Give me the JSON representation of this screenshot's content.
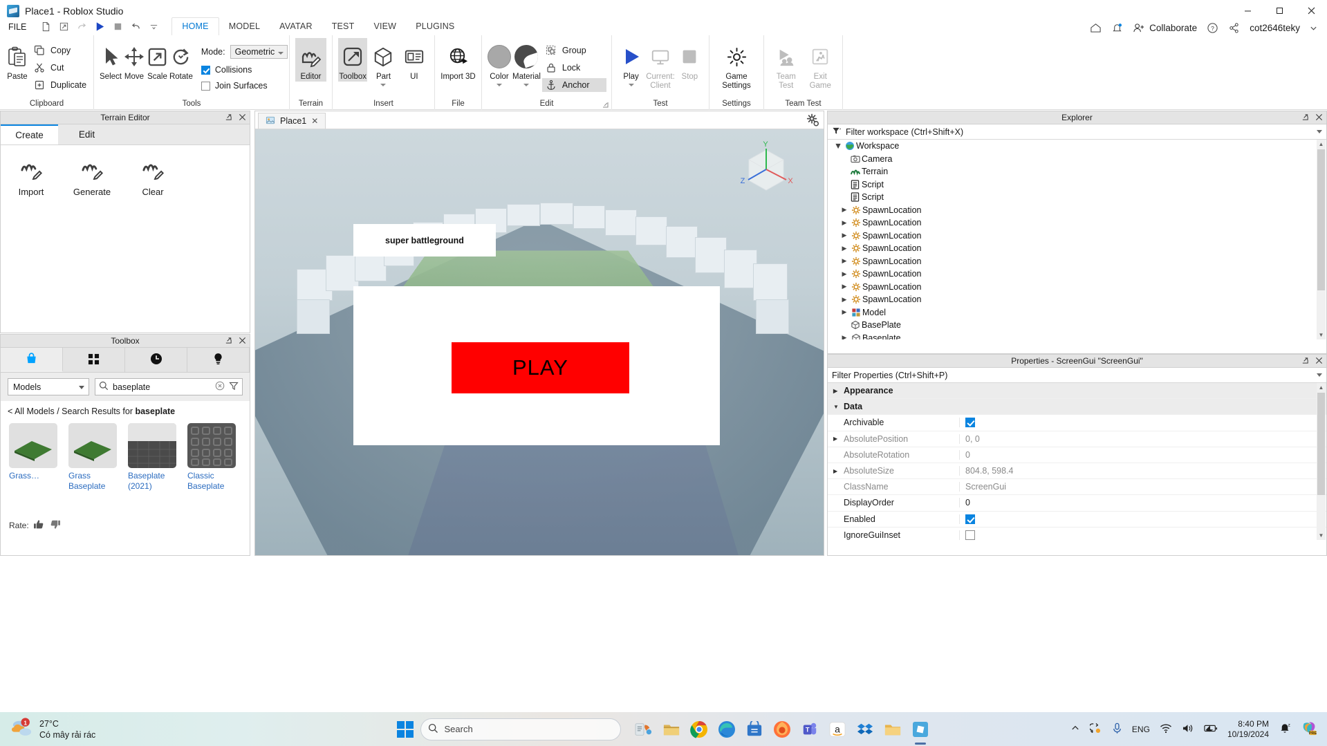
{
  "window": {
    "title": "Place1 - Roblox Studio",
    "minimize": "—",
    "maximize": "❐",
    "close": "✕"
  },
  "menu": {
    "file_label": "FILE",
    "quick_access": [
      "new-document-icon",
      "share-icon",
      "redo-icon",
      "play-icon",
      "stop-icon",
      "undo-icon",
      "more-icon"
    ],
    "tabs": [
      {
        "label": "HOME",
        "active": true
      },
      {
        "label": "MODEL",
        "active": false
      },
      {
        "label": "AVATAR",
        "active": false
      },
      {
        "label": "TEST",
        "active": false
      },
      {
        "label": "VIEW",
        "active": false
      },
      {
        "label": "PLUGINS",
        "active": false
      }
    ],
    "collaborate_label": "Collaborate",
    "user_name": "cot2646teky"
  },
  "ribbon": {
    "groups": [
      {
        "name": "Clipboard",
        "label": "Clipboard",
        "big": [
          {
            "label": "Paste",
            "icon": "paste-icon"
          }
        ],
        "small": [
          {
            "label": "Copy",
            "icon": "copy-icon"
          },
          {
            "label": "Cut",
            "icon": "cut-icon"
          },
          {
            "label": "Duplicate",
            "icon": "duplicate-icon"
          }
        ]
      },
      {
        "name": "Tools",
        "label": "Tools",
        "big": [
          {
            "label": "Select",
            "icon": "cursor-icon"
          },
          {
            "label": "Move",
            "icon": "move-icon"
          },
          {
            "label": "Scale",
            "icon": "scale-icon"
          },
          {
            "label": "Rotate",
            "icon": "rotate-icon"
          }
        ],
        "mode_label": "Mode:",
        "mode_value": "Geometric",
        "checkboxes": [
          {
            "label": "Collisions",
            "checked": true
          },
          {
            "label": "Join Surfaces",
            "checked": false
          }
        ]
      },
      {
        "name": "Terrain",
        "label": "Terrain",
        "big": [
          {
            "label": "Editor",
            "icon": "terrain-editor-icon",
            "selected": true
          }
        ]
      },
      {
        "name": "Insert",
        "label": "Insert",
        "big": [
          {
            "label": "Toolbox",
            "icon": "toolbox-icon",
            "selected": true
          },
          {
            "label": "Part",
            "icon": "part-cube-icon",
            "dropdown": true
          },
          {
            "label": "UI",
            "icon": "ui-icon"
          }
        ]
      },
      {
        "name": "File",
        "label": "File",
        "big": [
          {
            "label": "Import 3D",
            "icon": "import-3d-icon"
          }
        ]
      },
      {
        "name": "Edit",
        "label": "Edit",
        "big": [
          {
            "label": "Color",
            "icon": "color-swatch-icon",
            "dropdown": true
          },
          {
            "label": "Material",
            "icon": "material-sphere-icon",
            "dropdown": true
          }
        ],
        "small": [
          {
            "label": "Group",
            "icon": "group-icon",
            "dropdown": true
          },
          {
            "label": "Lock",
            "icon": "lock-icon",
            "dropdown": true
          },
          {
            "label": "Anchor",
            "icon": "anchor-icon",
            "selected": true
          }
        ]
      },
      {
        "name": "Test",
        "label": "Test",
        "big": [
          {
            "label": "Play",
            "icon": "play-triangle-icon",
            "dropdown": true
          },
          {
            "label": "Current: Client",
            "icon": "monitor-icon",
            "disabled": true
          },
          {
            "label": "Stop",
            "icon": "stop-square-icon",
            "disabled": true
          }
        ]
      },
      {
        "name": "Settings",
        "label": "Settings",
        "big": [
          {
            "label": "Game Settings",
            "icon": "gear-icon"
          }
        ]
      },
      {
        "name": "TeamTest",
        "label": "Team Test",
        "big": [
          {
            "label": "Team Test",
            "icon": "team-test-icon",
            "disabled": true
          },
          {
            "label": "Exit Game",
            "icon": "exit-game-icon",
            "disabled": true
          }
        ]
      }
    ]
  },
  "terrain_editor": {
    "title": "Terrain Editor",
    "tabs": [
      {
        "label": "Create",
        "active": true
      },
      {
        "label": "Edit",
        "active": false
      }
    ],
    "tools": [
      {
        "label": "Import",
        "icon": "terrain-import-icon"
      },
      {
        "label": "Generate",
        "icon": "terrain-generate-icon"
      },
      {
        "label": "Clear",
        "icon": "terrain-clear-icon"
      }
    ]
  },
  "toolbox": {
    "title": "Toolbox",
    "tabs": [
      {
        "icon": "shop-bag-icon",
        "active": true
      },
      {
        "icon": "inventory-grid-icon",
        "active": false
      },
      {
        "icon": "recent-clock-icon",
        "active": false
      },
      {
        "icon": "creations-bulb-icon",
        "active": false
      }
    ],
    "category": "Models",
    "search_value": "baseplate",
    "search_placeholder": "Search",
    "clear_icon": "clear-circle-icon",
    "filter_icon": "filter-icon",
    "breadcrumb_prefix": "< All Models / Search Results for ",
    "breadcrumb_query": "baseplate",
    "results": [
      {
        "name": "Grass…",
        "thumb": "grass-plate-thumb"
      },
      {
        "name": "Grass Baseplate",
        "thumb": "grass-plate-thumb"
      },
      {
        "name": "Baseplate (2021)",
        "thumb": "dark-baseplate-thumb"
      },
      {
        "name": "Classic Baseplate",
        "thumb": "studs-baseplate-thumb"
      }
    ],
    "rate_label": "Rate:"
  },
  "viewport": {
    "tab_label": "Place1",
    "tab_close": "✕",
    "tab_icon": "place-file-icon",
    "settings_icon": "viewport-settings-icon",
    "axis_labels": {
      "x": "X",
      "y": "Y",
      "z": "Z"
    },
    "gui_title_text": "super battleground",
    "play_button_label": "PLAY",
    "play_button_color": "#ff0000"
  },
  "explorer": {
    "title": "Explorer",
    "popout_icon": "popout-icon",
    "close_icon": "close-icon",
    "filter_placeholder": "Filter workspace (Ctrl+Shift+X)",
    "filter_icon": "funnel-icon",
    "items": [
      {
        "label": "Workspace",
        "icon": "workspace-globe-icon",
        "depth": 0,
        "expanded": true,
        "has_arrow": true
      },
      {
        "label": "Camera",
        "icon": "camera-icon",
        "depth": 1,
        "has_arrow": false
      },
      {
        "label": "Terrain",
        "icon": "terrain-icon",
        "depth": 1,
        "has_arrow": false
      },
      {
        "label": "Script",
        "icon": "script-icon",
        "depth": 1,
        "has_arrow": false
      },
      {
        "label": "Script",
        "icon": "script-icon",
        "depth": 1,
        "has_arrow": false
      },
      {
        "label": "SpawnLocation",
        "icon": "spawn-location-icon",
        "depth": 1,
        "has_arrow": true
      },
      {
        "label": "SpawnLocation",
        "icon": "spawn-location-icon",
        "depth": 1,
        "has_arrow": true
      },
      {
        "label": "SpawnLocation",
        "icon": "spawn-location-icon",
        "depth": 1,
        "has_arrow": true
      },
      {
        "label": "SpawnLocation",
        "icon": "spawn-location-icon",
        "depth": 1,
        "has_arrow": true
      },
      {
        "label": "SpawnLocation",
        "icon": "spawn-location-icon",
        "depth": 1,
        "has_arrow": true
      },
      {
        "label": "SpawnLocation",
        "icon": "spawn-location-icon",
        "depth": 1,
        "has_arrow": true
      },
      {
        "label": "SpawnLocation",
        "icon": "spawn-location-icon",
        "depth": 1,
        "has_arrow": true
      },
      {
        "label": "SpawnLocation",
        "icon": "spawn-location-icon",
        "depth": 1,
        "has_arrow": true
      },
      {
        "label": "Model",
        "icon": "model-icon",
        "depth": 1,
        "has_arrow": true
      },
      {
        "label": "BasePlate",
        "icon": "part-icon",
        "depth": 1,
        "has_arrow": false
      },
      {
        "label": "Baseplate",
        "icon": "part-icon",
        "depth": 1,
        "has_arrow": true
      }
    ]
  },
  "properties": {
    "title": "Properties - ScreenGui \"ScreenGui\"",
    "popout_icon": "popout-icon",
    "close_icon": "close-icon",
    "filter_placeholder": "Filter Properties (Ctrl+Shift+P)",
    "rows": [
      {
        "kind": "category",
        "name": "Appearance",
        "expanded": false
      },
      {
        "kind": "category",
        "name": "Data",
        "expanded": true
      },
      {
        "kind": "prop",
        "name": "Archivable",
        "value_type": "checkbox",
        "checked": true,
        "dim": false,
        "arrow": false
      },
      {
        "kind": "prop",
        "name": "AbsolutePosition",
        "value": "0, 0",
        "dim": true,
        "arrow": true
      },
      {
        "kind": "prop",
        "name": "AbsoluteRotation",
        "value": "0",
        "dim": true,
        "arrow": false
      },
      {
        "kind": "prop",
        "name": "AbsoluteSize",
        "value": "804.8, 598.4",
        "dim": true,
        "arrow": true
      },
      {
        "kind": "prop",
        "name": "ClassName",
        "value": "ScreenGui",
        "dim": true,
        "arrow": false
      },
      {
        "kind": "prop",
        "name": "DisplayOrder",
        "value": "0",
        "dim": false,
        "arrow": false
      },
      {
        "kind": "prop",
        "name": "Enabled",
        "value_type": "checkbox",
        "checked": true,
        "dim": false,
        "arrow": false
      },
      {
        "kind": "prop",
        "name": "IgnoreGuiInset",
        "value_type": "checkbox",
        "checked": false,
        "dim": false,
        "arrow": false
      }
    ]
  },
  "taskbar": {
    "weather_temp": "27°C",
    "weather_desc": "Có mây rải rác",
    "weather_badge": "1",
    "search_placeholder": "Search",
    "start_icon": "windows-start-icon",
    "apps": [
      {
        "name": "widgets-icon"
      },
      {
        "name": "file-explorer-icon"
      },
      {
        "name": "chrome-icon"
      },
      {
        "name": "edge-icon"
      },
      {
        "name": "store-icon"
      },
      {
        "name": "firefox-icon"
      },
      {
        "name": "teams-icon"
      },
      {
        "name": "amazon-icon"
      },
      {
        "name": "dropbox-icon"
      },
      {
        "name": "folder-icon"
      },
      {
        "name": "roblox-studio-icon"
      }
    ],
    "tray": {
      "chevron": "show-hidden-icon",
      "onedrive": "onedrive-sync-icon",
      "mic": "microphone-icon",
      "language": "ENG",
      "wifi": "wifi-icon",
      "volume": "volume-icon",
      "battery": "battery-icon",
      "notify": "notifications-icon",
      "copilot": "copilot-icon"
    },
    "time": "8:40 PM",
    "date": "10/19/2024"
  }
}
